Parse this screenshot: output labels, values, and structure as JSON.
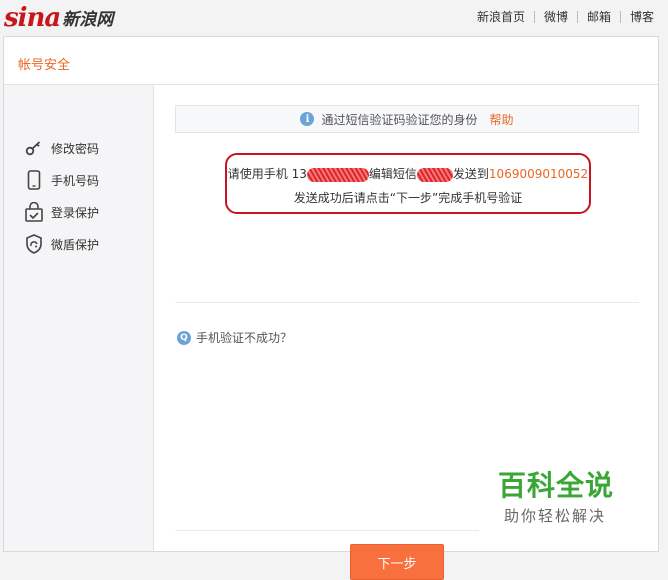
{
  "logo": {
    "brand": "sina",
    "cn": "新浪网"
  },
  "topnav": [
    {
      "label": "新浪首页"
    },
    {
      "label": "微博"
    },
    {
      "label": "邮箱"
    },
    {
      "label": "博客"
    }
  ],
  "card": {
    "title": "帐号安全"
  },
  "sidebar": {
    "items": [
      {
        "label": "修改密码",
        "icon": "key-icon"
      },
      {
        "label": "手机号码",
        "icon": "phone-icon"
      },
      {
        "label": "登录保护",
        "icon": "lock-check-icon"
      },
      {
        "label": "微盾保护",
        "icon": "shield-icon"
      }
    ]
  },
  "tip": {
    "text": "通过短信验证码验证您的身份",
    "help": "帮助"
  },
  "message": {
    "line1_a": "请使用手机 13",
    "line1_b": "编辑短信",
    "line1_c": "发送到",
    "number": "1069009010052",
    "line2": "发送成功后请点击“下一步”完成手机号验证"
  },
  "faq": {
    "icon_text": "Q",
    "text": "手机验证不成功？"
  },
  "next_button": "下一步",
  "watermark": {
    "main": "百科全说",
    "sub": "助你轻松解决"
  },
  "colors": {
    "accent": "#e96727",
    "brand_red": "#c8161d",
    "button": "#f7703e",
    "highlight_border": "#c8141e"
  }
}
